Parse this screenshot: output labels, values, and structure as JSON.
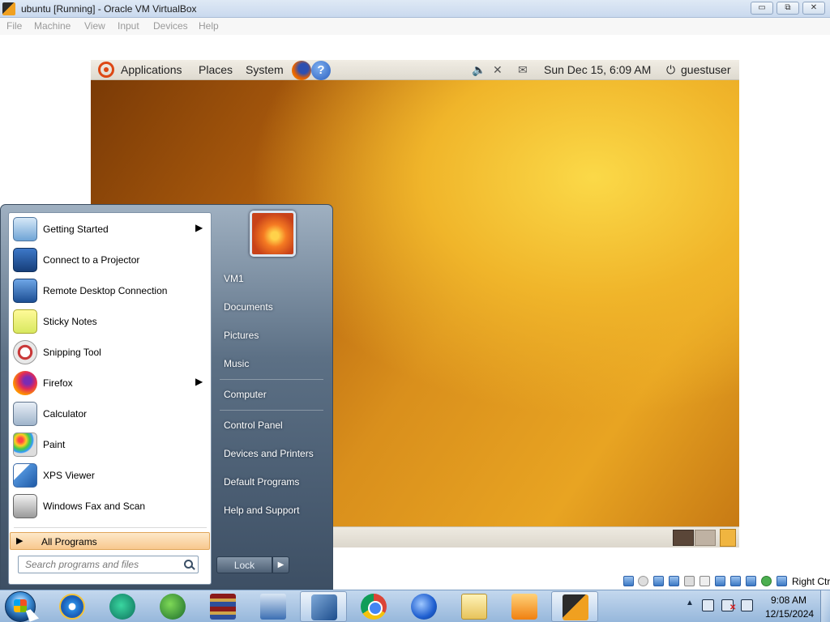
{
  "host_window": {
    "title": "ubuntu [Running] - Oracle VM VirtualBox",
    "buttons": {
      "minimize": "▭",
      "restore": "⧉",
      "close": "✕"
    },
    "menu": [
      "File",
      "Machine",
      "View",
      "Input",
      "Devices",
      "Help"
    ]
  },
  "guest": {
    "top_panel": {
      "menus": [
        "Applications",
        "Places",
        "System"
      ],
      "tray_icons": [
        "volume-icon",
        "network-icon",
        "mail-icon"
      ],
      "datetime": "Sun Dec 15,  6:09 AM",
      "user": "guestuser",
      "power_glyph": "⏻"
    },
    "colors": {
      "desktop_dark": "#7a3a06",
      "desktop_light": "#fbd948",
      "ubuntu_orange": "#dd4814"
    }
  },
  "vbox_status": {
    "host_key": "Right Ctrl"
  },
  "start_menu": {
    "programs": [
      {
        "label": "Getting Started",
        "icon": "getting-started-icon",
        "has_submenu": true
      },
      {
        "label": "Connect to a Projector",
        "icon": "projector-icon",
        "has_submenu": false
      },
      {
        "label": "Remote Desktop Connection",
        "icon": "remote-desktop-icon",
        "has_submenu": false
      },
      {
        "label": "Sticky Notes",
        "icon": "sticky-notes-icon",
        "has_submenu": false
      },
      {
        "label": "Snipping Tool",
        "icon": "snipping-tool-icon",
        "has_submenu": false
      },
      {
        "label": "Firefox",
        "icon": "firefox-icon",
        "has_submenu": true
      },
      {
        "label": "Calculator",
        "icon": "calculator-icon",
        "has_submenu": false
      },
      {
        "label": "Paint",
        "icon": "paint-icon",
        "has_submenu": false
      },
      {
        "label": "XPS Viewer",
        "icon": "xps-viewer-icon",
        "has_submenu": false
      },
      {
        "label": "Windows Fax and Scan",
        "icon": "fax-scan-icon",
        "has_submenu": false
      }
    ],
    "all_programs": "All Programs",
    "search_placeholder": "Search programs and files",
    "right_items": [
      "VM1",
      "Documents",
      "Pictures",
      "Music",
      "Computer",
      "Control Panel",
      "Devices and Printers",
      "Default Programs",
      "Help and Support"
    ],
    "lock_label": "Lock",
    "submenu_arrow": "▶",
    "lock_arrow": "▶"
  },
  "taskbar": {
    "apps": [
      "internet-explorer-icon",
      "teams-icon",
      "download-manager-icon",
      "winrar-icon",
      "setup-icon",
      "virtualbox-icon",
      "chrome-icon",
      "thunderbird-icon",
      "file-explorer-icon",
      "media-player-icon",
      "virtualbox-vm-icon"
    ],
    "active_app": "virtualbox-icon",
    "clock_time": "9:08 AM",
    "clock_date": "12/15/2024",
    "tray_up": "▲"
  }
}
